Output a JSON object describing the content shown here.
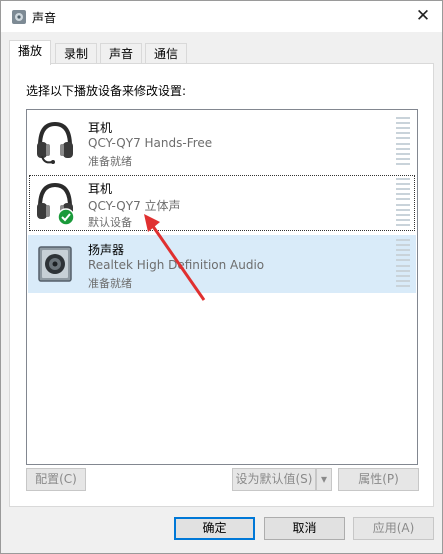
{
  "window": {
    "title": "声音",
    "close_glyph": "✕"
  },
  "tabs": [
    {
      "label": "播放",
      "active": true
    },
    {
      "label": "录制",
      "active": false
    },
    {
      "label": "声音",
      "active": false
    },
    {
      "label": "通信",
      "active": false
    }
  ],
  "instruction": "选择以下播放设备来修改设置:",
  "devices": [
    {
      "name": "耳机",
      "description": "QCY-QY7 Hands-Free",
      "status": "准备就绪",
      "icon": "headset-icon"
    },
    {
      "name": "耳机",
      "description": "QCY-QY7 立体声",
      "status": "默认设备",
      "icon": "headphones-default-icon",
      "default_badge": "check-icon"
    },
    {
      "name": "扬声器",
      "description": "Realtek High Definition Audio",
      "status": "准备就绪",
      "icon": "speaker-icon",
      "selected": true
    }
  ],
  "buttons": {
    "configure": "配置(C)",
    "set_default": "设为默认值(S)",
    "set_default_dropdown": "▾",
    "properties": "属性(P)",
    "ok": "确定",
    "cancel": "取消",
    "apply": "应用(A)"
  },
  "colors": {
    "accent": "#0078d7",
    "selection": "#d9ebf9",
    "annotation_arrow": "#e03030",
    "check_badge": "#1a9a3a"
  }
}
